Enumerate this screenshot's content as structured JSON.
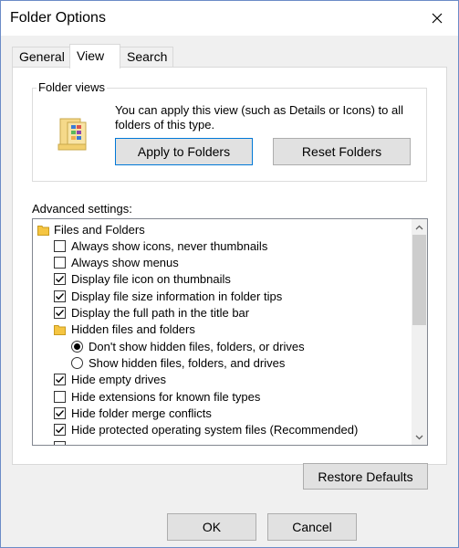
{
  "window": {
    "title": "Folder Options"
  },
  "tabs": [
    {
      "label": "General",
      "active": false
    },
    {
      "label": "View",
      "active": true
    },
    {
      "label": "Search",
      "active": false
    }
  ],
  "folder_views": {
    "legend": "Folder views",
    "description": "You can apply this view (such as Details or Icons) to all folders of this type.",
    "apply_label": "Apply to Folders",
    "reset_label": "Reset Folders"
  },
  "advanced": {
    "label": "Advanced settings:",
    "items": [
      {
        "type": "folder",
        "text": "Files and Folders"
      },
      {
        "type": "checkbox",
        "text": "Always show icons, never thumbnails",
        "checked": false
      },
      {
        "type": "checkbox",
        "text": "Always show menus",
        "checked": false
      },
      {
        "type": "checkbox",
        "text": "Display file icon on thumbnails",
        "checked": true
      },
      {
        "type": "checkbox",
        "text": "Display file size information in folder tips",
        "checked": true
      },
      {
        "type": "checkbox",
        "text": "Display the full path in the title bar",
        "checked": true
      },
      {
        "type": "folder",
        "text": "Hidden files and folders"
      },
      {
        "type": "radio",
        "text": "Don't show hidden files, folders, or drives",
        "checked": true
      },
      {
        "type": "radio",
        "text": "Show hidden files, folders, and drives",
        "checked": false
      },
      {
        "type": "checkbox",
        "text": "Hide empty drives",
        "checked": true
      },
      {
        "type": "checkbox",
        "text": "Hide extensions for known file types",
        "checked": false
      },
      {
        "type": "checkbox",
        "text": "Hide folder merge conflicts",
        "checked": true
      },
      {
        "type": "checkbox",
        "text": "Hide protected operating system files (Recommended)",
        "checked": true
      },
      {
        "type": "checkbox",
        "text": "",
        "checked": false
      }
    ]
  },
  "restore_label": "Restore Defaults",
  "footer": {
    "ok_label": "OK",
    "cancel_label": "Cancel"
  },
  "icons": {
    "close": "close-icon",
    "folder": "folder-icon",
    "scroll_up": "chevron-up-icon",
    "scroll_down": "chevron-down-icon"
  }
}
